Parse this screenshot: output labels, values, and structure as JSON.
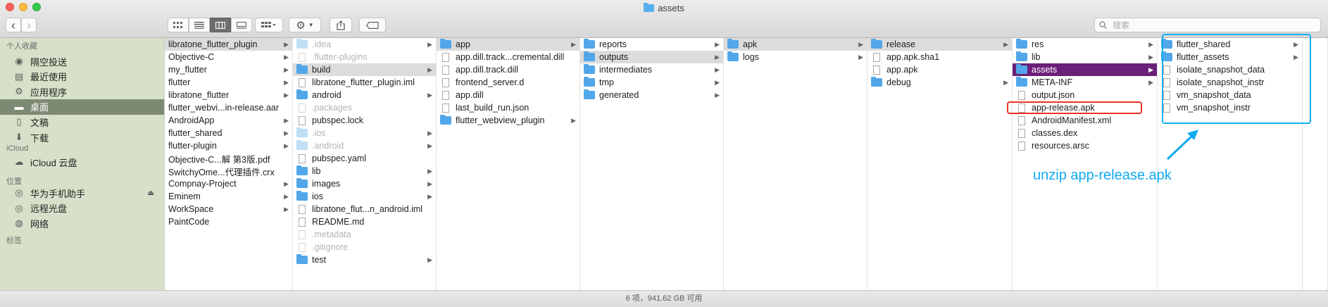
{
  "window": {
    "title": "assets"
  },
  "toolbar": {
    "back_glyph": "‹",
    "forward_glyph": "›",
    "view_icons": [
      "icon-view-icon",
      "list-view-icon",
      "column-view-icon",
      "gallery-view-icon"
    ],
    "search_placeholder": "搜索"
  },
  "sidebar": {
    "sections": [
      {
        "header": "个人收藏",
        "items": [
          {
            "label": "隔空投送",
            "icon": "airdrop-icon"
          },
          {
            "label": "最近使用",
            "icon": "recents-icon"
          },
          {
            "label": "应用程序",
            "icon": "applications-icon"
          },
          {
            "label": "桌面",
            "icon": "desktop-icon",
            "selected": true
          },
          {
            "label": "文稿",
            "icon": "documents-icon"
          },
          {
            "label": "下载",
            "icon": "downloads-icon"
          }
        ]
      },
      {
        "header": "iCloud",
        "items": [
          {
            "label": "iCloud 云盘",
            "icon": "icloud-icon"
          }
        ]
      },
      {
        "header": "位置",
        "items": [
          {
            "label": "华为手机助手",
            "icon": "disk-icon",
            "eject": true
          },
          {
            "label": "远程光盘",
            "icon": "disc-icon"
          },
          {
            "label": "网络",
            "icon": "network-icon"
          }
        ]
      },
      {
        "header": "标签",
        "items": []
      }
    ]
  },
  "columns": [
    {
      "items": [
        {
          "name": "libratone_flutter_plugin",
          "type": "plain",
          "chevron": true,
          "state": "hl"
        },
        {
          "name": "Objective-C",
          "type": "plain",
          "chevron": true
        },
        {
          "name": "my_flutter",
          "type": "plain",
          "chevron": true
        },
        {
          "name": "flutter",
          "type": "plain",
          "chevron": true
        },
        {
          "name": "libratone_flutter",
          "type": "plain",
          "chevron": true
        },
        {
          "name": "flutter_webvi...in-release.aar",
          "type": "plain",
          "chevron": false
        },
        {
          "name": "AndroidApp",
          "type": "plain",
          "chevron": true
        },
        {
          "name": "flutter_shared",
          "type": "plain",
          "chevron": true
        },
        {
          "name": "flutter-plugin",
          "type": "plain",
          "chevron": true
        },
        {
          "name": "Objective-C...解 第3版.pdf",
          "type": "plain",
          "chevron": false
        },
        {
          "name": "SwitchyOme...代理插件.crx",
          "type": "plain",
          "chevron": false
        },
        {
          "name": "Compnay-Project",
          "type": "plain",
          "chevron": true
        },
        {
          "name": "Eminem",
          "type": "plain",
          "chevron": true
        },
        {
          "name": "WorkSpace",
          "type": "plain",
          "chevron": true
        },
        {
          "name": "PaintCode",
          "type": "plain",
          "chevron": false
        }
      ]
    },
    {
      "items": [
        {
          "name": ".idea",
          "type": "folder",
          "chevron": true,
          "state": "dim"
        },
        {
          "name": ".flutter-plugins",
          "type": "file",
          "chevron": false,
          "state": "dim"
        },
        {
          "name": "build",
          "type": "folder",
          "chevron": true,
          "state": "hl"
        },
        {
          "name": "libratone_flutter_plugin.iml",
          "type": "file",
          "chevron": false
        },
        {
          "name": "android",
          "type": "folder",
          "chevron": true
        },
        {
          "name": ".packages",
          "type": "file",
          "chevron": false,
          "state": "dim"
        },
        {
          "name": "pubspec.lock",
          "type": "file",
          "chevron": false
        },
        {
          "name": ".ios",
          "type": "folder",
          "chevron": true,
          "state": "dim"
        },
        {
          "name": ".android",
          "type": "folder",
          "chevron": true,
          "state": "dim"
        },
        {
          "name": "pubspec.yaml",
          "type": "file",
          "chevron": false
        },
        {
          "name": "lib",
          "type": "folder",
          "chevron": true
        },
        {
          "name": "images",
          "type": "folder",
          "chevron": true
        },
        {
          "name": "ios",
          "type": "folder",
          "chevron": true
        },
        {
          "name": "libratone_flut...n_android.iml",
          "type": "file",
          "chevron": false
        },
        {
          "name": "README.md",
          "type": "file",
          "chevron": false
        },
        {
          "name": ".metadata",
          "type": "file",
          "chevron": false,
          "state": "dim"
        },
        {
          "name": ".gitignore",
          "type": "file",
          "chevron": false,
          "state": "dim"
        },
        {
          "name": "test",
          "type": "folder",
          "chevron": true
        }
      ]
    },
    {
      "items": [
        {
          "name": "app",
          "type": "folder",
          "chevron": true,
          "state": "hl"
        },
        {
          "name": "app.dill.track...cremental.dill",
          "type": "file",
          "chevron": false
        },
        {
          "name": "app.dill.track.dill",
          "type": "file",
          "chevron": false
        },
        {
          "name": "frontend_server.d",
          "type": "file",
          "chevron": false
        },
        {
          "name": "app.dill",
          "type": "file",
          "chevron": false
        },
        {
          "name": "last_build_run.json",
          "type": "file",
          "chevron": false
        },
        {
          "name": "flutter_webview_plugin",
          "type": "folder",
          "chevron": true
        }
      ]
    },
    {
      "items": [
        {
          "name": "reports",
          "type": "folder",
          "chevron": true
        },
        {
          "name": "outputs",
          "type": "folder",
          "chevron": true,
          "state": "hl"
        },
        {
          "name": "intermediates",
          "type": "folder",
          "chevron": true
        },
        {
          "name": "tmp",
          "type": "folder",
          "chevron": true
        },
        {
          "name": "generated",
          "type": "folder",
          "chevron": true
        }
      ]
    },
    {
      "items": [
        {
          "name": "apk",
          "type": "folder",
          "chevron": true,
          "state": "hl"
        },
        {
          "name": "logs",
          "type": "folder",
          "chevron": true
        }
      ]
    },
    {
      "items": [
        {
          "name": "release",
          "type": "folder",
          "chevron": true,
          "state": "hl"
        },
        {
          "name": "app.apk.sha1",
          "type": "file",
          "chevron": false
        },
        {
          "name": "app.apk",
          "type": "file",
          "chevron": false
        },
        {
          "name": "debug",
          "type": "folder",
          "chevron": true
        }
      ]
    },
    {
      "items": [
        {
          "name": "res",
          "type": "folder",
          "chevron": true
        },
        {
          "name": "lib",
          "type": "folder",
          "chevron": true
        },
        {
          "name": "assets",
          "type": "folder",
          "chevron": true,
          "state": "sel"
        },
        {
          "name": "META-INF",
          "type": "folder",
          "chevron": true
        },
        {
          "name": "output.json",
          "type": "file",
          "chevron": false
        },
        {
          "name": "app-release.apk",
          "type": "file",
          "chevron": false
        },
        {
          "name": "AndroidManifest.xml",
          "type": "file",
          "chevron": false
        },
        {
          "name": "classes.dex",
          "type": "file",
          "chevron": false
        },
        {
          "name": "resources.arsc",
          "type": "file",
          "chevron": false
        }
      ]
    },
    {
      "items": [
        {
          "name": "flutter_shared",
          "type": "folder",
          "chevron": true
        },
        {
          "name": "flutter_assets",
          "type": "folder",
          "chevron": true
        },
        {
          "name": "isolate_snapshot_data",
          "type": "file",
          "chevron": false
        },
        {
          "name": "isolate_snapshot_instr",
          "type": "file",
          "chevron": false
        },
        {
          "name": "vm_snapshot_data",
          "type": "file",
          "chevron": false
        },
        {
          "name": "vm_snapshot_instr",
          "type": "file",
          "chevron": false
        }
      ]
    },
    {
      "items": []
    }
  ],
  "status": {
    "text": "6 项，941.62 GB 可用"
  },
  "annotation": {
    "text": "unzip app-release.apk"
  },
  "colors": {
    "selection": "#6c1f79",
    "annotation_blue": "#10aaf0",
    "annotation_red": "#e8342a",
    "sidebar_bg": "#d7e0c8"
  }
}
